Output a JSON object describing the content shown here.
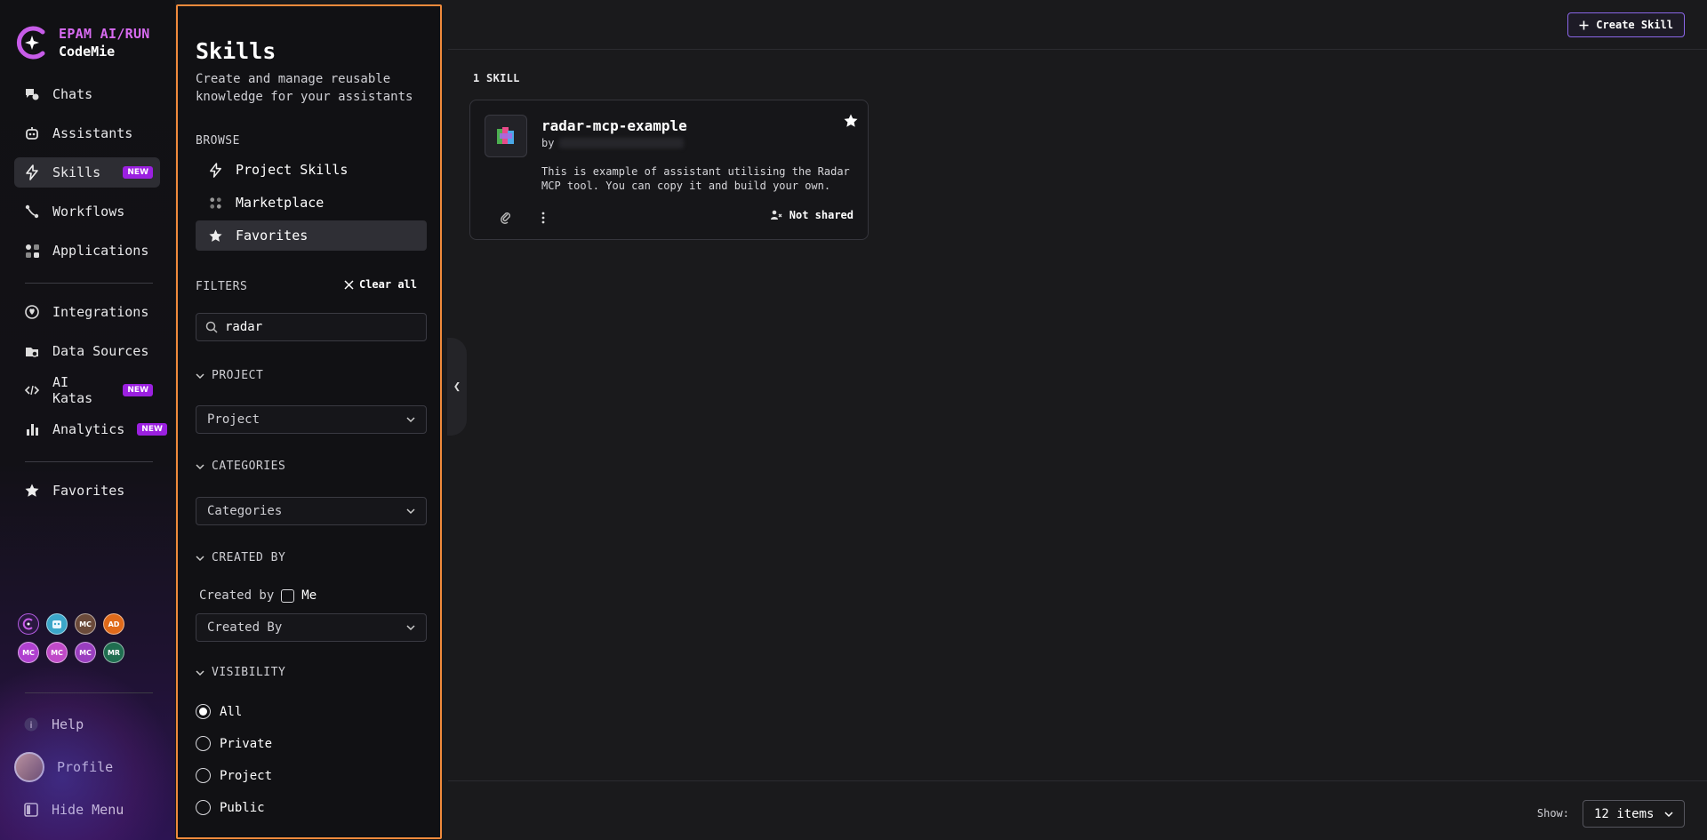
{
  "brand": {
    "line1": "EPAM AI/RUN",
    "line2": "CodeMie",
    "accent": "#d86bf2"
  },
  "nav": {
    "items": [
      {
        "label": "Chats",
        "icon": "chats-icon"
      },
      {
        "label": "Assistants",
        "icon": "robot-icon"
      },
      {
        "label": "Skills",
        "icon": "lightning-icon",
        "badge": "NEW",
        "active": true
      },
      {
        "label": "Workflows",
        "icon": "workflow-icon"
      },
      {
        "label": "Applications",
        "icon": "apps-icon"
      },
      {
        "label": "Integrations",
        "icon": "integrations-icon"
      },
      {
        "label": "Data Sources",
        "icon": "database-icon"
      },
      {
        "label": "AI Katas",
        "icon": "code-icon",
        "badge": "NEW"
      },
      {
        "label": "Analytics",
        "icon": "analytics-icon",
        "badge": "NEW"
      },
      {
        "label": "Favorites",
        "icon": "star-icon"
      }
    ],
    "avatars": [
      "MC",
      "AD",
      "MC",
      "MC",
      "MC",
      "MR"
    ],
    "help": "Help",
    "profile": "Profile",
    "hide_menu": "Hide Menu"
  },
  "panel": {
    "title": "Skills",
    "subtitle": "Create and manage reusable knowledge for your assistants",
    "browse_label": "BROWSE",
    "browse_items": [
      "Project Skills",
      "Marketplace",
      "Favorites"
    ],
    "filters_label": "FILTERS",
    "clear_all": "Clear all",
    "search_value": "radar",
    "project_head": "PROJECT",
    "project_select": "Project",
    "categories_head": "CATEGORIES",
    "categories_select": "Categories",
    "created_by_head": "CREATED BY",
    "created_by_text": "Created by",
    "me_label": "Me",
    "created_by_select": "Created By",
    "visibility_head": "VISIBILITY",
    "visibility_options": [
      "All",
      "Private",
      "Project",
      "Public"
    ],
    "visibility_selected": "All"
  },
  "main": {
    "create_button": "Create Skill",
    "count_label": "1 SKILL",
    "card": {
      "title": "radar-mcp-example",
      "by": "by",
      "description": "This is example of assistant utilising the Radar MCP tool. You can copy it and build your own.",
      "sharing": "Not shared"
    },
    "show_label": "Show:",
    "show_value": "12 items"
  }
}
